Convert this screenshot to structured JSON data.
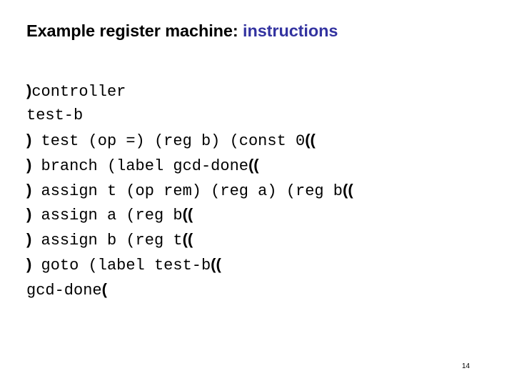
{
  "slide": {
    "title_main": "Example register machine: ",
    "title_accent": "instructions",
    "accent_color": "#3333a0",
    "page_number": "14",
    "code_lines": [
      [
        {
          "t": ")",
          "p": true
        },
        {
          "t": "controller"
        }
      ],
      [
        {
          "t": "test-b"
        }
      ],
      [
        {
          "t": ")",
          "p": true
        },
        {
          "t": " test (op =) (reg b) (const 0"
        },
        {
          "t": "((",
          "p": true
        }
      ],
      [
        {
          "t": ")",
          "p": true
        },
        {
          "t": " branch (label gcd-done"
        },
        {
          "t": "((",
          "p": true
        }
      ],
      [
        {
          "t": ")",
          "p": true
        },
        {
          "t": " assign t (op rem) (reg a) (reg b"
        },
        {
          "t": "((",
          "p": true
        }
      ],
      [
        {
          "t": ")",
          "p": true
        },
        {
          "t": " assign a (reg b"
        },
        {
          "t": "((",
          "p": true
        }
      ],
      [
        {
          "t": ")",
          "p": true
        },
        {
          "t": " assign b (reg t"
        },
        {
          "t": "((",
          "p": true
        }
      ],
      [
        {
          "t": ")",
          "p": true
        },
        {
          "t": " goto (label test-b"
        },
        {
          "t": "((",
          "p": true
        }
      ],
      [
        {
          "t": "gcd-done"
        },
        {
          "t": "(",
          "p": true
        }
      ]
    ]
  }
}
